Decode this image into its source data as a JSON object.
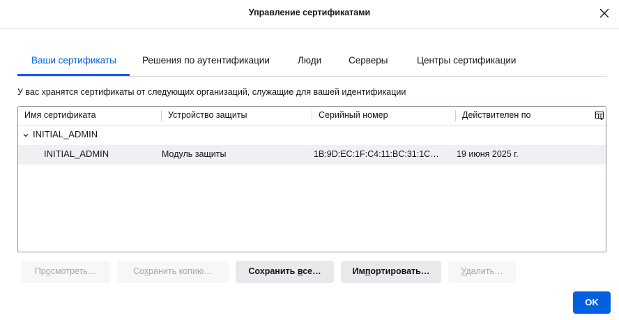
{
  "dialog": {
    "title": "Управление сертификатами"
  },
  "tabs": [
    {
      "label": "Ваши сертификаты",
      "active": true
    },
    {
      "label": "Решения по аутентификации",
      "active": false
    },
    {
      "label": "Люди",
      "active": false
    },
    {
      "label": "Серверы",
      "active": false
    },
    {
      "label": "Центры сертификации",
      "active": false
    }
  ],
  "description": "У вас хранятся сертификаты от следующих организаций, служащие для вашей идентификации",
  "table": {
    "columns": [
      "Имя сертификата",
      "Устройство защиты",
      "Серийный номер",
      "Действителен по"
    ],
    "column_picker_icon": "column-picker-icon",
    "groups": [
      {
        "name": "INITIAL_ADMIN",
        "expanded": true,
        "rows": [
          {
            "name": "INITIAL_ADMIN",
            "device": "Модуль защиты",
            "serial": "1B:9D:EC:1F:C4:11:BC:31:1C…",
            "valid_until": "19 июня 2025 г."
          }
        ]
      }
    ]
  },
  "buttons": {
    "view": {
      "pre": "Пр",
      "key": "о",
      "post": "смотреть…",
      "enabled": false
    },
    "save_copy": {
      "pre": "Со",
      "key": "х",
      "post": "ранить копию…",
      "enabled": false
    },
    "save_all": {
      "pre": "Сохранить ",
      "key": "в",
      "post": "се…",
      "enabled": true
    },
    "import": {
      "pre": "Им",
      "key": "п",
      "post": "ортировать…",
      "enabled": true
    },
    "delete": {
      "pre": "",
      "key": "У",
      "post": "далить…",
      "enabled": false
    }
  },
  "ok_label": "OK",
  "colors": {
    "accent": "#0061e0",
    "disabled_text": "#a5a5ab",
    "button_bg": "#e9e9ed"
  }
}
